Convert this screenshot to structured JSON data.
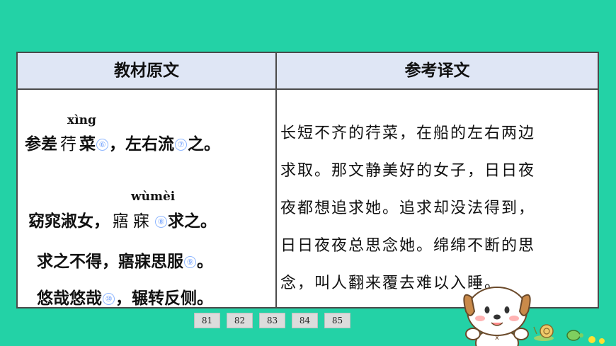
{
  "table": {
    "header_left": "教材原文",
    "header_right": "参考译文",
    "original": {
      "pinyin1": "xìng",
      "line1": {
        "a": "参差",
        "b": "荇",
        "c": "菜",
        "n1": "⑥",
        "d": "，左右流",
        "n2": "⑦",
        "e": "之。"
      },
      "pinyin2": "wùmèi",
      "line2": {
        "a": "窈窕淑女，",
        "b": "寤",
        "c": "寐",
        "n": "⑧",
        "d": "求之。"
      },
      "line3": {
        "a": "求之不得，寤寐思服",
        "n": "⑨",
        "b": "。"
      },
      "line4": {
        "a": "悠哉悠哉",
        "n": "⑩",
        "b": "，辗转反侧。"
      }
    },
    "translation_lines": [
      "长短不齐的荇菜，在船的左右两边",
      "求取。那文静美好的女子，日日夜",
      "夜都想追求她。追求却没法得到，",
      "日日夜夜总思念她。绵绵不断的思",
      "念，叫人翻来覆去难以入睡。"
    ]
  },
  "pager": [
    "81",
    "82",
    "83",
    "84",
    "85"
  ],
  "colors": {
    "background": "#23d2a6",
    "header": "#dfe6f5",
    "border": "#4b4b4b",
    "note": "#6fa0ff"
  },
  "icons": {
    "mascot": "cartoon-dog-icon",
    "snail": "snail-icon",
    "turtle": "turtle-icon"
  }
}
